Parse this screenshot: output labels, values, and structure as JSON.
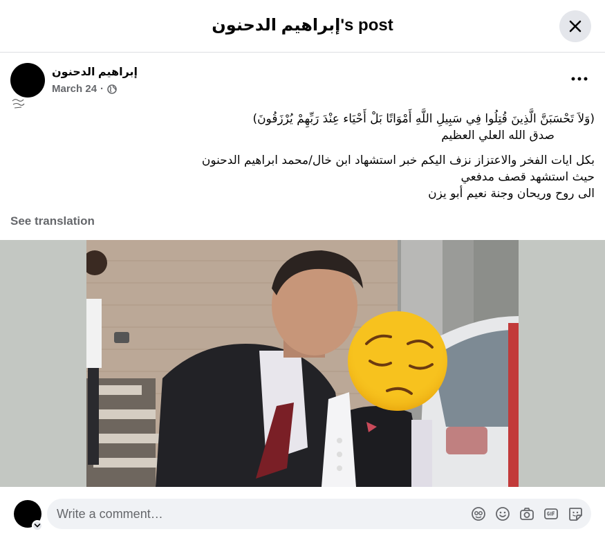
{
  "header": {
    "title": "إبراهيم الدحنون's post"
  },
  "post": {
    "author_name": "إبراهيم الدحنون",
    "date": "March 24",
    "separator": "·",
    "verse_line_1": "(وَلاَ تَحْسَبَنَّ الَّذِينَ قُتِلُوا فِي سَبِيلِ اللَّهِ أَمْوَاتًا بَلْ أَحْيَاء عِنْدَ رَبِّهِمْ يُرْزَقُونَ)",
    "verse_line_2": "صدق الله العلي العظيم",
    "body_line_1": "بكل ايات الفخر والاعتزاز نزف اليكم خبر استشهاد ابن خال/محمد ابراهيم الدحنون",
    "body_line_2": "حيث استشهد قصف مدفعي",
    "body_line_3": "الى روح وريحان وجنة نعيم أبو يزن",
    "see_translation": "See translation"
  },
  "comment": {
    "placeholder": "Write a comment…"
  },
  "icons": {
    "close": "close-icon",
    "more": "more-options-icon",
    "globe": "globe-icon",
    "avatar_sticker": "avatar-sticker-icon",
    "emoji": "emoji-icon",
    "camera": "camera-icon",
    "gif": "gif-icon",
    "sticker": "sticker-icon"
  },
  "colors": {
    "background": "#ffffff",
    "secondary_text": "#65676b",
    "input_bg": "#f0f2f5",
    "button_bg": "#e4e6eb"
  }
}
